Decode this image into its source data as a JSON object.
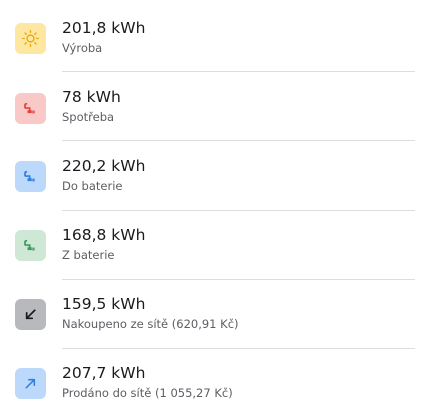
{
  "energy_list": {
    "items": [
      {
        "value": "201,8 kWh",
        "label": "Výroba",
        "icon": "sun-icon",
        "bg": "#fde7a1",
        "fg": "#e6a817"
      },
      {
        "value": "78 kWh",
        "label": "Spotřeba",
        "icon": "plug-icon",
        "bg": "#f8c9c6",
        "fg": "#e0453a"
      },
      {
        "value": "220,2 kWh",
        "label": "Do baterie",
        "icon": "plug-icon",
        "bg": "#bcd9fb",
        "fg": "#2f7fe0"
      },
      {
        "value": "168,8 kWh",
        "label": "Z baterie",
        "icon": "plug-icon",
        "bg": "#cfe8d6",
        "fg": "#3b9a5a"
      },
      {
        "value": "159,5 kWh",
        "label": "Nakoupeno ze sítě (620,91 Kč)",
        "icon": "arrow-down-left-icon",
        "bg": "#b7b9bc",
        "fg": "#1b1b1f"
      },
      {
        "value": "207,7 kWh",
        "label": "Prodáno do sítě (1 055,27 Kč)",
        "icon": "arrow-up-right-icon",
        "bg": "#bcd9fb",
        "fg": "#2f7fe0"
      }
    ]
  }
}
